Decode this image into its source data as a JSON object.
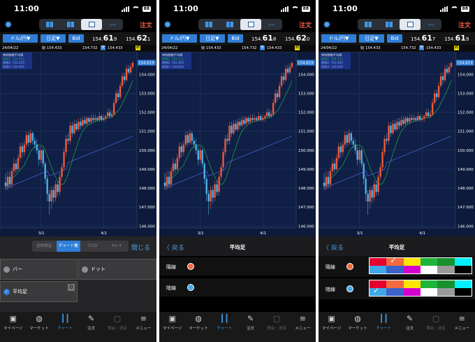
{
  "status": {
    "time": "11:00",
    "battery": "88"
  },
  "topbar": {
    "order": "注文",
    "tabs": [
      "grid",
      "list",
      "single",
      "trend"
    ],
    "active_tab": 2
  },
  "quote": {
    "pair": "ドル/円▼",
    "period": "日足▼",
    "side": "Bid"
  },
  "screens": [
    {
      "bid_small": "154.",
      "bid_big": "61",
      "bid_sub": "9",
      "ask_small": "154.",
      "ask_big": "62",
      "ask_sub": "1"
    },
    {
      "bid_small": "154.",
      "bid_big": "61",
      "bid_sub": "8",
      "ask_small": "154.",
      "ask_big": "62",
      "ask_sub": "0"
    },
    {
      "bid_small": "154.",
      "bid_big": "61",
      "bid_sub": "7",
      "ask_small": "154.",
      "ask_big": "61",
      "ask_sub": "9"
    }
  ],
  "info": {
    "date": "24/04/22",
    "open_label": "始",
    "open": "154.433",
    "high": "154.732",
    "low_label": "安",
    "low": "154.433",
    "close_label": "終"
  },
  "legend": {
    "title": "単純移動平均線",
    "ma1": "期間1: 154.2xx",
    "ma2": "期間2: 152.425",
    "ma3": "期間3: 149.826"
  },
  "chart_data": {
    "type": "candlestick",
    "ylim": [
      145.9,
      154.9
    ],
    "yticks": [
      "154.000",
      "153.000",
      "152.000",
      "151.000",
      "150.000",
      "149.000",
      "148.000",
      "147.000",
      "146.000"
    ],
    "xticks": [
      "3/1",
      "4/1"
    ],
    "last_label": "154.619",
    "up_color": "#f05a3a",
    "down_color": "#4fb0e8",
    "ma_short_color": "#1e9e3e",
    "ma_long_color": "#4b5bc8",
    "candles": [
      [
        148.3,
        148.1,
        148.8,
        147.9
      ],
      [
        148.1,
        148.6,
        148.9,
        147.9
      ],
      [
        148.6,
        148.2,
        148.9,
        148.0
      ],
      [
        148.2,
        148.9,
        149.1,
        148.0
      ],
      [
        148.9,
        149.3,
        149.6,
        148.7
      ],
      [
        149.3,
        149.0,
        149.5,
        148.8
      ],
      [
        149.0,
        149.6,
        149.8,
        148.9
      ],
      [
        149.6,
        150.2,
        150.4,
        149.4
      ],
      [
        150.2,
        149.9,
        150.4,
        149.6
      ],
      [
        149.9,
        150.3,
        150.5,
        149.7
      ],
      [
        150.3,
        150.8,
        151.0,
        150.1
      ],
      [
        150.8,
        150.4,
        151.0,
        150.2
      ],
      [
        150.4,
        150.9,
        151.1,
        150.3
      ],
      [
        150.9,
        150.5,
        151.0,
        150.3
      ],
      [
        150.5,
        150.3,
        150.7,
        150.1
      ],
      [
        150.3,
        150.0,
        150.6,
        149.8
      ],
      [
        150.0,
        149.5,
        150.2,
        149.2
      ],
      [
        149.5,
        150.0,
        150.2,
        149.3
      ],
      [
        150.0,
        149.3,
        150.1,
        149.1
      ],
      [
        149.3,
        148.5,
        149.4,
        148.2
      ],
      [
        148.5,
        147.7,
        148.7,
        147.3
      ],
      [
        147.7,
        147.3,
        147.9,
        146.6
      ],
      [
        147.3,
        147.9,
        148.1,
        146.9
      ],
      [
        147.9,
        147.5,
        148.1,
        147.2
      ],
      [
        147.5,
        148.2,
        148.4,
        147.3
      ],
      [
        148.2,
        147.8,
        148.4,
        147.6
      ],
      [
        147.8,
        148.6,
        148.8,
        147.6
      ],
      [
        148.6,
        149.1,
        149.3,
        148.4
      ],
      [
        149.1,
        149.9,
        150.1,
        148.9
      ],
      [
        149.9,
        150.6,
        150.8,
        149.7
      ],
      [
        150.6,
        150.5,
        150.9,
        150.3
      ],
      [
        150.5,
        151.3,
        151.5,
        150.3
      ],
      [
        151.3,
        150.9,
        151.5,
        150.7
      ],
      [
        150.9,
        151.4,
        151.6,
        150.8
      ],
      [
        151.4,
        151.1,
        151.6,
        151.0
      ],
      [
        151.1,
        151.5,
        151.7,
        151.0
      ],
      [
        151.5,
        151.3,
        151.7,
        151.1
      ],
      [
        151.3,
        151.6,
        151.8,
        151.2
      ],
      [
        151.6,
        151.4,
        151.8,
        151.3
      ],
      [
        151.4,
        151.7,
        151.8,
        151.3
      ],
      [
        151.7,
        151.5,
        151.8,
        151.4
      ],
      [
        151.5,
        151.7,
        151.9,
        151.4
      ],
      [
        151.7,
        151.6,
        151.9,
        151.5
      ],
      [
        151.6,
        151.7,
        151.9,
        151.5
      ],
      [
        151.7,
        151.6,
        151.8,
        151.5
      ],
      [
        151.6,
        151.8,
        152.0,
        151.5
      ],
      [
        151.8,
        151.6,
        151.9,
        151.5
      ],
      [
        151.6,
        151.7,
        151.9,
        151.5
      ],
      [
        151.7,
        151.8,
        151.9,
        151.5
      ],
      [
        151.8,
        152.0,
        152.2,
        151.7
      ],
      [
        152.0,
        151.8,
        152.2,
        151.7
      ],
      [
        151.8,
        151.9,
        152.1,
        151.7
      ],
      [
        151.9,
        152.5,
        152.7,
        151.8
      ],
      [
        152.5,
        153.0,
        153.2,
        152.4
      ],
      [
        153.0,
        152.8,
        153.2,
        152.6
      ],
      [
        152.8,
        153.4,
        153.6,
        152.7
      ],
      [
        153.4,
        153.9,
        154.1,
        153.3
      ],
      [
        153.9,
        153.7,
        154.1,
        153.5
      ],
      [
        153.7,
        154.3,
        154.5,
        153.6
      ],
      [
        154.3,
        154.1,
        154.5,
        154.0
      ],
      [
        154.1,
        154.4,
        154.6,
        154.0
      ],
      [
        154.4,
        154.6,
        154.7,
        154.3
      ]
    ]
  },
  "chart_settings_menu": {
    "segments": [
      "全体設定",
      "チャート種",
      "ﾃｸﾆｶﾙ",
      "ｵｼﾚｰﾀ"
    ],
    "active_segment": 1,
    "close": "閉じる",
    "options": {
      "bar": "バー",
      "dot": "ドット",
      "ma": "平均足"
    }
  },
  "avg_settings": {
    "back": "戻る",
    "title": "平均足",
    "bull_label": "陽線",
    "bear_label": "陰線",
    "bull_color": "#f26a3d",
    "bear_color": "#46aee8",
    "palette": [
      "#e6002d",
      "#f26a3d",
      "#ffe600",
      "#1fb43a",
      "#16912e",
      "#00f0ff",
      "#3fa8e8",
      "#3c63c9",
      "#d400d0",
      "#ffffff",
      "#9a9a9a",
      "#000000"
    ]
  },
  "nav": [
    "マイページ",
    "マーケット",
    "チャート",
    "注文",
    "照会・決済",
    "メニュー"
  ]
}
